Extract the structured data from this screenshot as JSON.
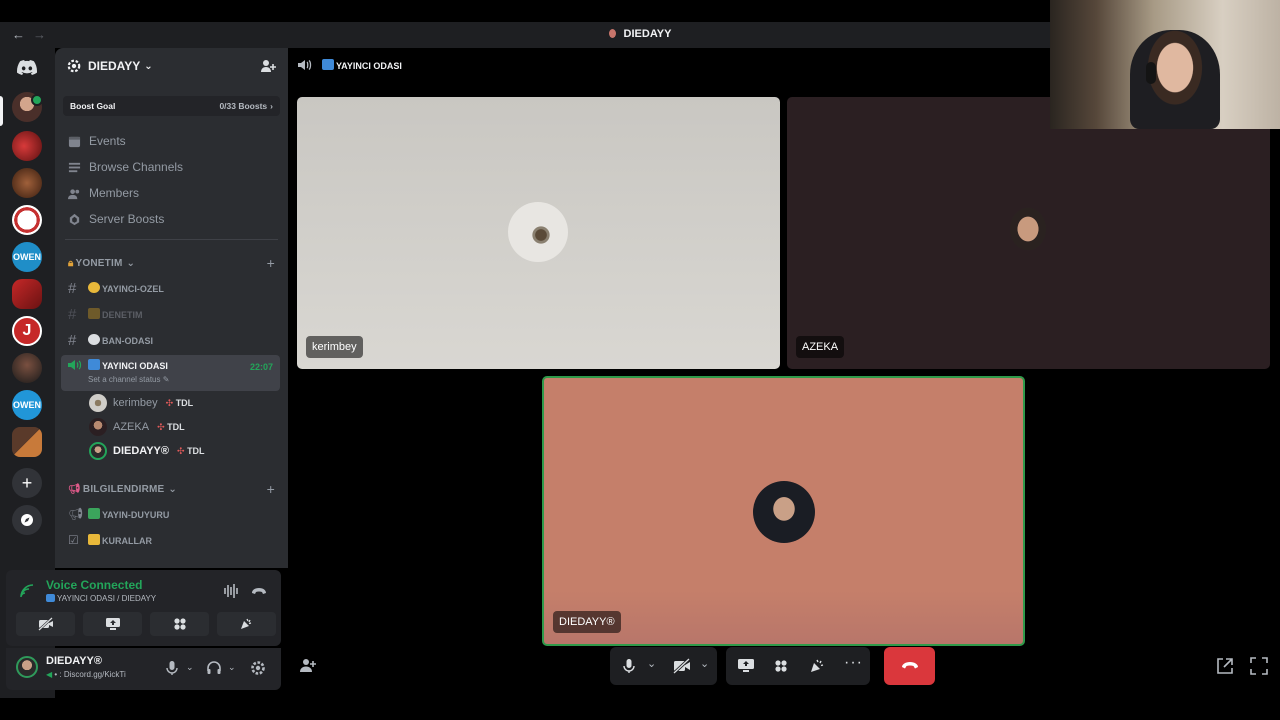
{
  "window": {
    "title": "DIEDAYY"
  },
  "server": {
    "name": "DIEDAYY",
    "boost_label": "Boost Goal",
    "boost_count": "0/33 Boosts"
  },
  "menu": [
    {
      "label": "Events",
      "icon": "calendar-icon"
    },
    {
      "label": "Browse Channels",
      "icon": "list-icon"
    },
    {
      "label": "Members",
      "icon": "members-icon"
    },
    {
      "label": "Server Boosts",
      "icon": "boost-icon"
    }
  ],
  "categories": {
    "yonetim": "YONETIM",
    "bilgilendirme": "BILGILENDIRME"
  },
  "channels": {
    "yayinci_ozel": "YAYINCI-OZEL",
    "denetim": "DENETIM",
    "ban_odasi": "BAN-ODASI",
    "yayin_duyuru": "YAYIN-DUYURU",
    "kurallar": "KURALLAR"
  },
  "voice_channel": {
    "name": "YAYINCI ODASI",
    "time": "22:07",
    "status_placeholder": "Set a channel status",
    "users": [
      {
        "name": "kerimbey",
        "tag": "TDL"
      },
      {
        "name": "AZEKA",
        "tag": "TDL"
      },
      {
        "name": "DIEDAYY®",
        "tag": "TDL"
      }
    ]
  },
  "voice_panel": {
    "status": "Voice Connected",
    "location": "YAYINCI ODASI / DIEDAYY"
  },
  "user_panel": {
    "name": "DIEDAYY®",
    "status": ": Discord.gg/KickTi"
  },
  "main": {
    "channel_title": "YAYINCI ODASI",
    "tiles": [
      {
        "name": "kerimbey"
      },
      {
        "name": "AZEKA"
      },
      {
        "name": "DIEDAYY®"
      }
    ]
  },
  "colors": {
    "accent_green": "#23a55a",
    "end_call": "#da373c",
    "tile_kerimbey": "#cfcdc8",
    "tile_azeka": "#2b1f22",
    "tile_diedayy": "#c57f6a"
  }
}
